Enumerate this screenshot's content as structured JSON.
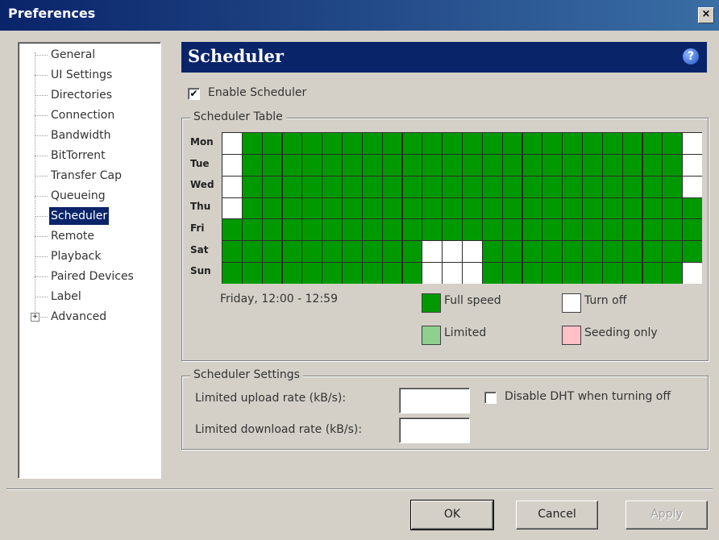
{
  "window": {
    "title": "Preferences",
    "close_label": "×"
  },
  "sidebar": {
    "items": [
      {
        "label": "General"
      },
      {
        "label": "UI Settings"
      },
      {
        "label": "Directories"
      },
      {
        "label": "Connection"
      },
      {
        "label": "Bandwidth"
      },
      {
        "label": "BitTorrent"
      },
      {
        "label": "Transfer Cap"
      },
      {
        "label": "Queueing"
      },
      {
        "label": "Scheduler",
        "selected": true
      },
      {
        "label": "Remote"
      },
      {
        "label": "Playback"
      },
      {
        "label": "Paired Devices"
      },
      {
        "label": "Label"
      },
      {
        "label": "Advanced",
        "expandable": true
      }
    ],
    "expander_glyph": "+"
  },
  "panel": {
    "title": "Scheduler",
    "help_glyph": "?"
  },
  "enable_scheduler": {
    "label": "Enable Scheduler",
    "checked": true,
    "check_glyph": "✔"
  },
  "scheduler_table": {
    "title": "Scheduler Table",
    "days": [
      "Mon",
      "Tue",
      "Wed",
      "Thu",
      "Fri",
      "Sat",
      "Sun"
    ],
    "hours": 24,
    "state_colors": {
      "F": "#009a00",
      "O": "#ffffff",
      "L": "#8fd08f",
      "S": "#ffc0c8"
    },
    "rows": [
      "OFFFFFFFFFFFFFFFFFFFFFFO",
      "OFFFFFFFFFFFFFFFFFFFFFFO",
      "OFFFFFFFFFFFFFFFFFFFFFFO",
      "OFFFFFFFFFFFFFFFFFFFFFFF",
      "FFFFFFFFFFFFFFFFFFFFFFFF",
      "FFFFFFFFFFOOOFFFFFFFFFFF",
      "FFFFFFFFFFOOOFFFFFFFFFFO"
    ],
    "hover_text": "Friday, 12:00 - 12:59",
    "legend": [
      {
        "state": "F",
        "label": "Full speed"
      },
      {
        "state": "O",
        "label": "Turn off"
      },
      {
        "state": "L",
        "label": "Limited"
      },
      {
        "state": "S",
        "label": "Seeding only"
      }
    ]
  },
  "scheduler_settings": {
    "title": "Scheduler Settings",
    "upload_label": "Limited upload rate (kB/s):",
    "upload_value": "",
    "download_label": "Limited download rate (kB/s):",
    "download_value": "",
    "disable_dht_label": "Disable DHT when turning off",
    "disable_dht_checked": false
  },
  "buttons": {
    "ok": "OK",
    "cancel": "Cancel",
    "apply": "Apply"
  }
}
